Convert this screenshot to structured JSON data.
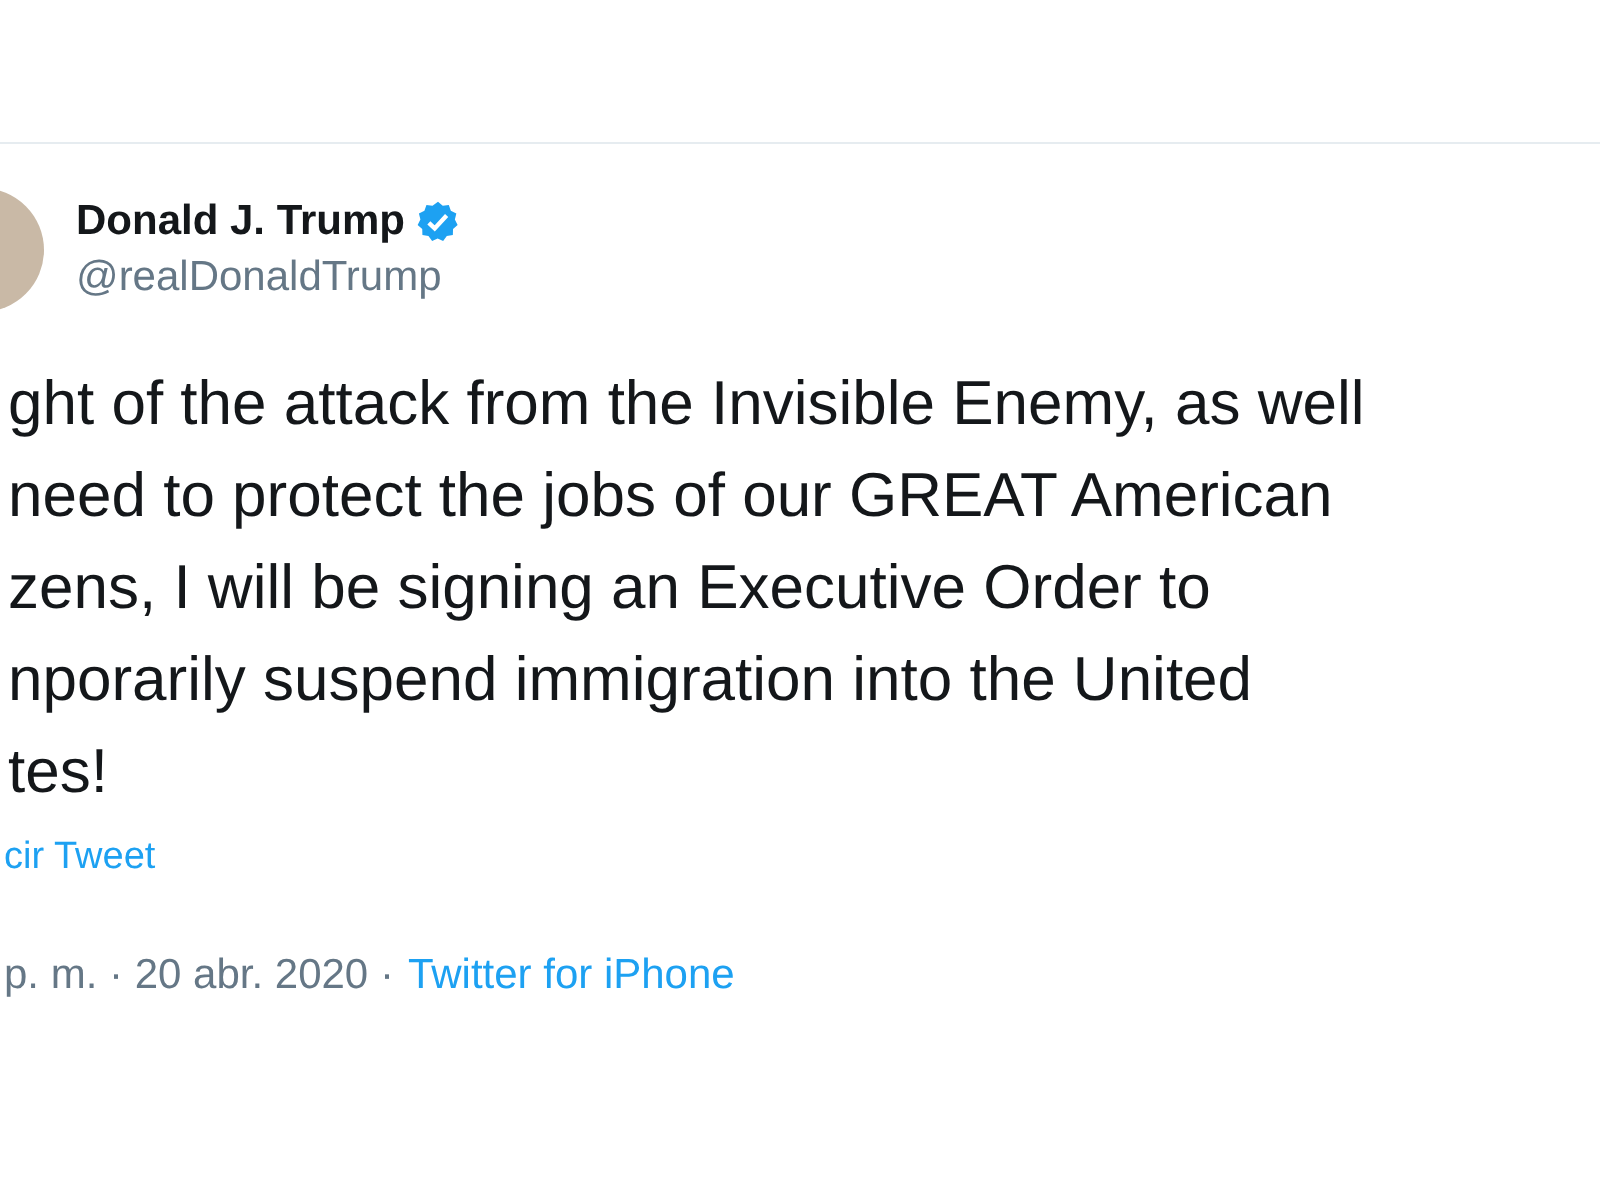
{
  "author": {
    "name": "Donald J. Trump",
    "verified": true,
    "handle": "@realDonaldTrump"
  },
  "text_lines": [
    "ght of the attack from the Invisible Enemy, as well",
    "need to protect the jobs of our GREAT American",
    "zens, I will be signing an Executive Order to",
    "nporarily suspend immigration into the United",
    "tes!"
  ],
  "translate_link": "cir Tweet",
  "meta": {
    "time_date": "p. m. · 20 abr. 2020 ·",
    "source": "Twitter for iPhone"
  }
}
